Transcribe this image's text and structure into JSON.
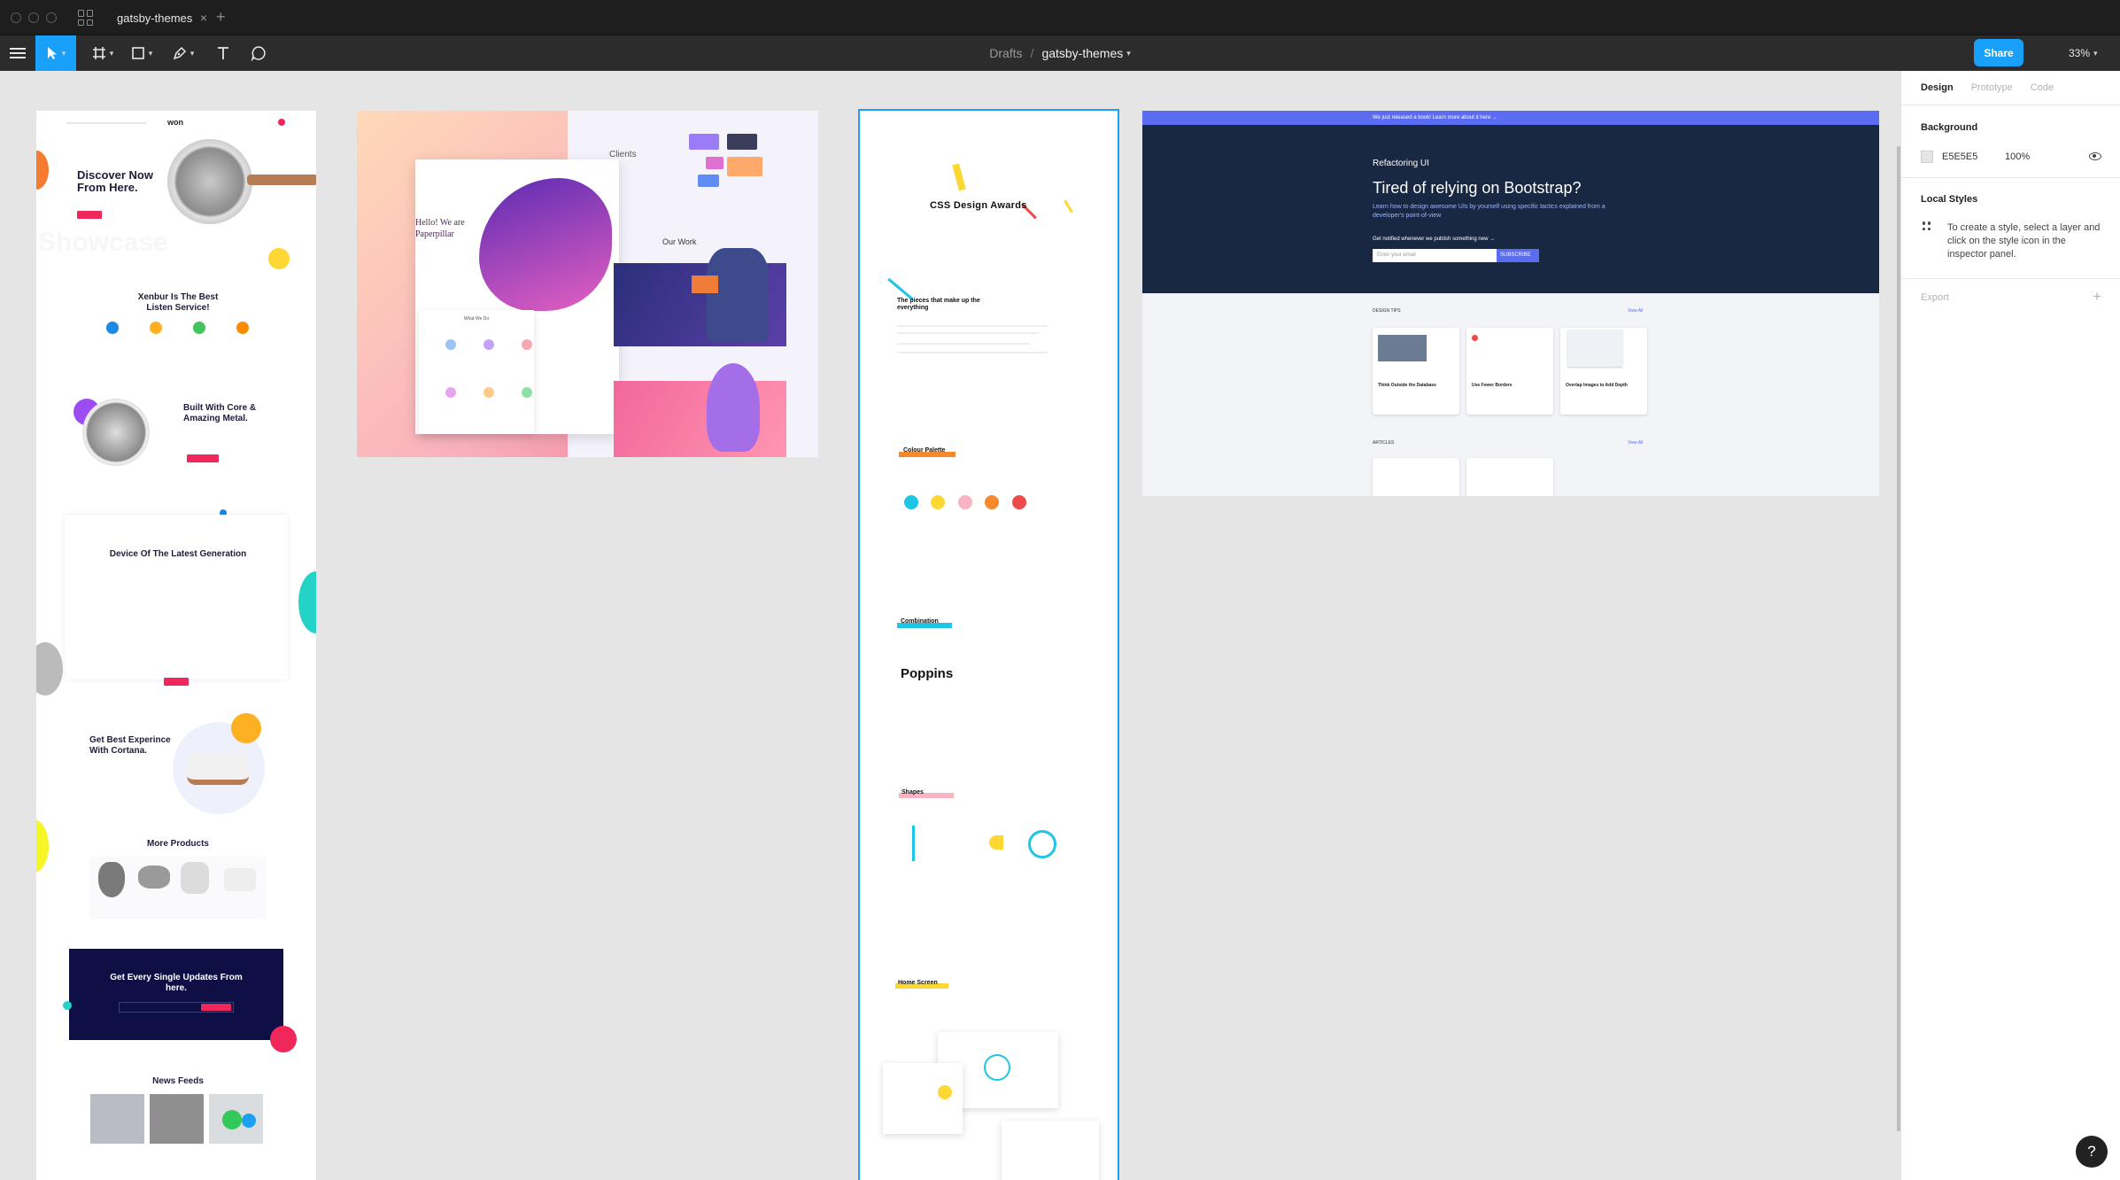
{
  "titlebar": {
    "tab_title": "gatsby-themes",
    "tab_close": "×",
    "add_tab": "+"
  },
  "toolbar": {
    "breadcrumb_parent": "Drafts",
    "breadcrumb_separator": "/",
    "file_name": "gatsby-themes",
    "share_label": "Share",
    "zoom_level": "33%",
    "accent_color": "#18a0fb"
  },
  "canvas": {
    "background": "#E5E5E5",
    "frame1": {
      "logo": "won",
      "hero_title": "Discover Now From Here.",
      "watermark": "Showcase",
      "section_1": "Xenbur Is The Best Listen Service!",
      "section_2": "Built With Core & Amazing Metal.",
      "section_3": "Device Of The Latest Generation",
      "section_4": "Get Best Experince With Cortana.",
      "section_5": "More Products",
      "section_6": "Get Every Single Updates From here.",
      "section_7": "News Feeds"
    },
    "frame2": {
      "hero_title": "Hello! We are Paperpillar",
      "clients": "Clients",
      "our_work": "Our Work",
      "what_we_do": "What We Do"
    },
    "frame3": {
      "title": "CSS Design Awards",
      "pieces": "The pieces that make up the everything",
      "colour_palette": "Colour Palette",
      "combination": "Combination",
      "font_name": "Poppins",
      "shapes": "Shapes",
      "home_screen": "Home Screen",
      "palette_colors": [
        "#1ec6e6",
        "#fdd835",
        "#f9b4c4",
        "#f58a2d",
        "#ef4a4a"
      ]
    },
    "frame4": {
      "banner": "We just released a book! Learn more about it here →",
      "brand": "Refactoring UI",
      "hero_title": "Tired of relying on Bootstrap?",
      "hero_sub": "Learn how to design awesome UIs by yourself using specific tactics explained from a developer's point-of-view",
      "notify": "Get notified whenever we publish something new →",
      "email_placeholder": "Enter your email",
      "subscribe": "SUBSCRIBE",
      "design_tips": "DESIGN TIPS",
      "view_all": "View All",
      "articles": "ARTICLES",
      "card_1": "Think Outside the Database",
      "card_2": "Use Fewer Borders",
      "card_3": "Overlap Images to Add Depth"
    }
  },
  "panel": {
    "tabs": [
      "Design",
      "Prototype",
      "Code"
    ],
    "background_heading": "Background",
    "background_hex": "E5E5E5",
    "background_opacity": "100%",
    "local_styles_heading": "Local Styles",
    "local_styles_text": "To create a style, select a layer and click on the style icon in the inspector panel.",
    "export_label": "Export",
    "export_add": "+"
  },
  "help_label": "?"
}
